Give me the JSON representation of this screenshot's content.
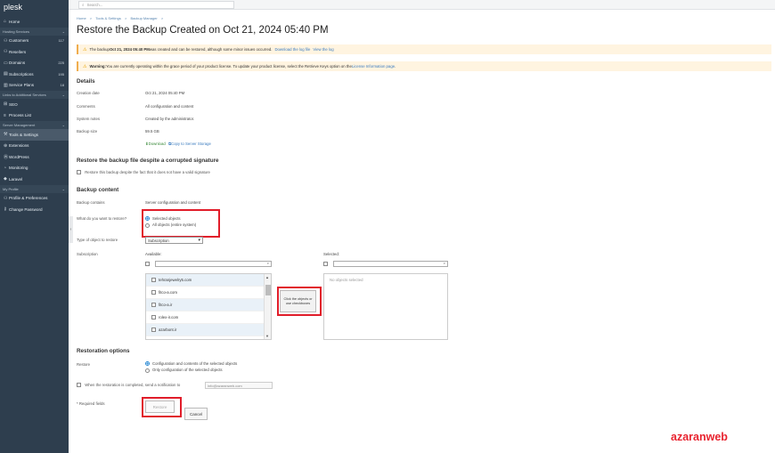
{
  "sidebar": {
    "logo": "plesk",
    "items": [
      {
        "type": "item",
        "icon": "⌂",
        "label": "Home"
      },
      {
        "type": "section",
        "label": "Hosting Services"
      },
      {
        "type": "item",
        "icon": "⚇",
        "label": "Customers",
        "count": "117"
      },
      {
        "type": "item",
        "icon": "⚇",
        "label": "Resellers"
      },
      {
        "type": "item",
        "icon": "▭",
        "label": "Domains",
        "count": "225"
      },
      {
        "type": "item",
        "icon": "▤",
        "label": "Subscriptions",
        "count": "195"
      },
      {
        "type": "item",
        "icon": "▥",
        "label": "Service Plans",
        "count": "18"
      },
      {
        "type": "section",
        "label": "Links to Additional Services"
      },
      {
        "type": "item",
        "icon": "⊞",
        "label": "SEO"
      },
      {
        "type": "item",
        "icon": "≡",
        "label": "Process List"
      },
      {
        "type": "section",
        "label": "Server Management"
      },
      {
        "type": "item",
        "icon": "⚒",
        "label": "Tools & Settings",
        "active": true
      },
      {
        "type": "item",
        "icon": "⊕",
        "label": "Extensions"
      },
      {
        "type": "item",
        "icon": "Ⓦ",
        "label": "WordPress"
      },
      {
        "type": "item",
        "icon": "◔",
        "label": "Monitoring"
      },
      {
        "type": "item",
        "icon": "◆",
        "label": "Laravel"
      },
      {
        "type": "section",
        "label": "My Profile"
      },
      {
        "type": "item",
        "icon": "⚇",
        "label": "Profile & Preferences"
      },
      {
        "type": "item",
        "icon": "⚷",
        "label": "Change Password"
      }
    ]
  },
  "search": {
    "placeholder": "Search..."
  },
  "breadcrumb": [
    "Home",
    ">",
    "Tools & Settings",
    ">",
    "Backup Manager",
    ">"
  ],
  "page_title": "Restore the Backup Created on Oct 21, 2024 05:40 PM",
  "alert_backup": {
    "prefix": "The backup ",
    "date": "Oct 21, 2024 05:40 PM",
    "text": " was created and can be restored, although some minor issues occurred.",
    "link1": "Download the log file",
    "link2": "View the log"
  },
  "alert_license": {
    "bold": "Warning:",
    "text": " You are currently operating within the grace period of your product license. To update your product license, select the Retrieve Keys option on the ",
    "link": "License Information page",
    "suffix": "."
  },
  "details": {
    "heading": "Details",
    "rows": [
      {
        "label": "Creation date",
        "value": "Oct 21, 2024 05:40 PM"
      },
      {
        "label": "Comments",
        "value": "All configuration and content"
      },
      {
        "label": "System notes",
        "value": "Created by the administrator."
      },
      {
        "label": "Backup size",
        "value": "59.5 GB"
      }
    ],
    "download": "Download",
    "copy": "Copy to Server Storage"
  },
  "corrupted": {
    "heading": "Restore the backup file despite a corrupted signature",
    "checkbox_label": "Restore this backup despite the fact that it does not have a valid signature"
  },
  "content": {
    "heading": "Backup content",
    "contains_label": "Backup contains",
    "contains_value": "Server configuration and content",
    "what_label": "What do you want to restore?",
    "option_selected": "Selected objects",
    "option_all": "All objects (entire system)",
    "type_label": "Type of object to restore",
    "type_value": "Subscription",
    "subscription_label": "Subscription",
    "available_label": "Available:",
    "selected_label": "Selected:",
    "available_items": [
      "tehranjewelry5.com",
      "fitco-a.com",
      "fitco-a.ir",
      "rolex-ir.com",
      "azarbont.ir"
    ],
    "no_objects": "No objects selected",
    "move_button": "Click the objects or use checkboxes"
  },
  "restoration": {
    "heading": "Restoration options",
    "restore_label": "Restore",
    "option_config_content": "Configuration and contents of the selected objects",
    "option_config_only": "Only configuration of the selected objects",
    "notify_label": "When the restoration is completed, send a notification to",
    "notify_email": "info@azaranweb.com"
  },
  "footer": {
    "required": "* Required fields",
    "restore_button": "Restore",
    "cancel_button": "Cancel"
  },
  "watermark": "azaranweb",
  "colors": {
    "sidebar": "#2e3e4e",
    "highlight_box": "#e11d2a",
    "alert_bg": "#fff4e0",
    "link": "#3a7bbf"
  }
}
